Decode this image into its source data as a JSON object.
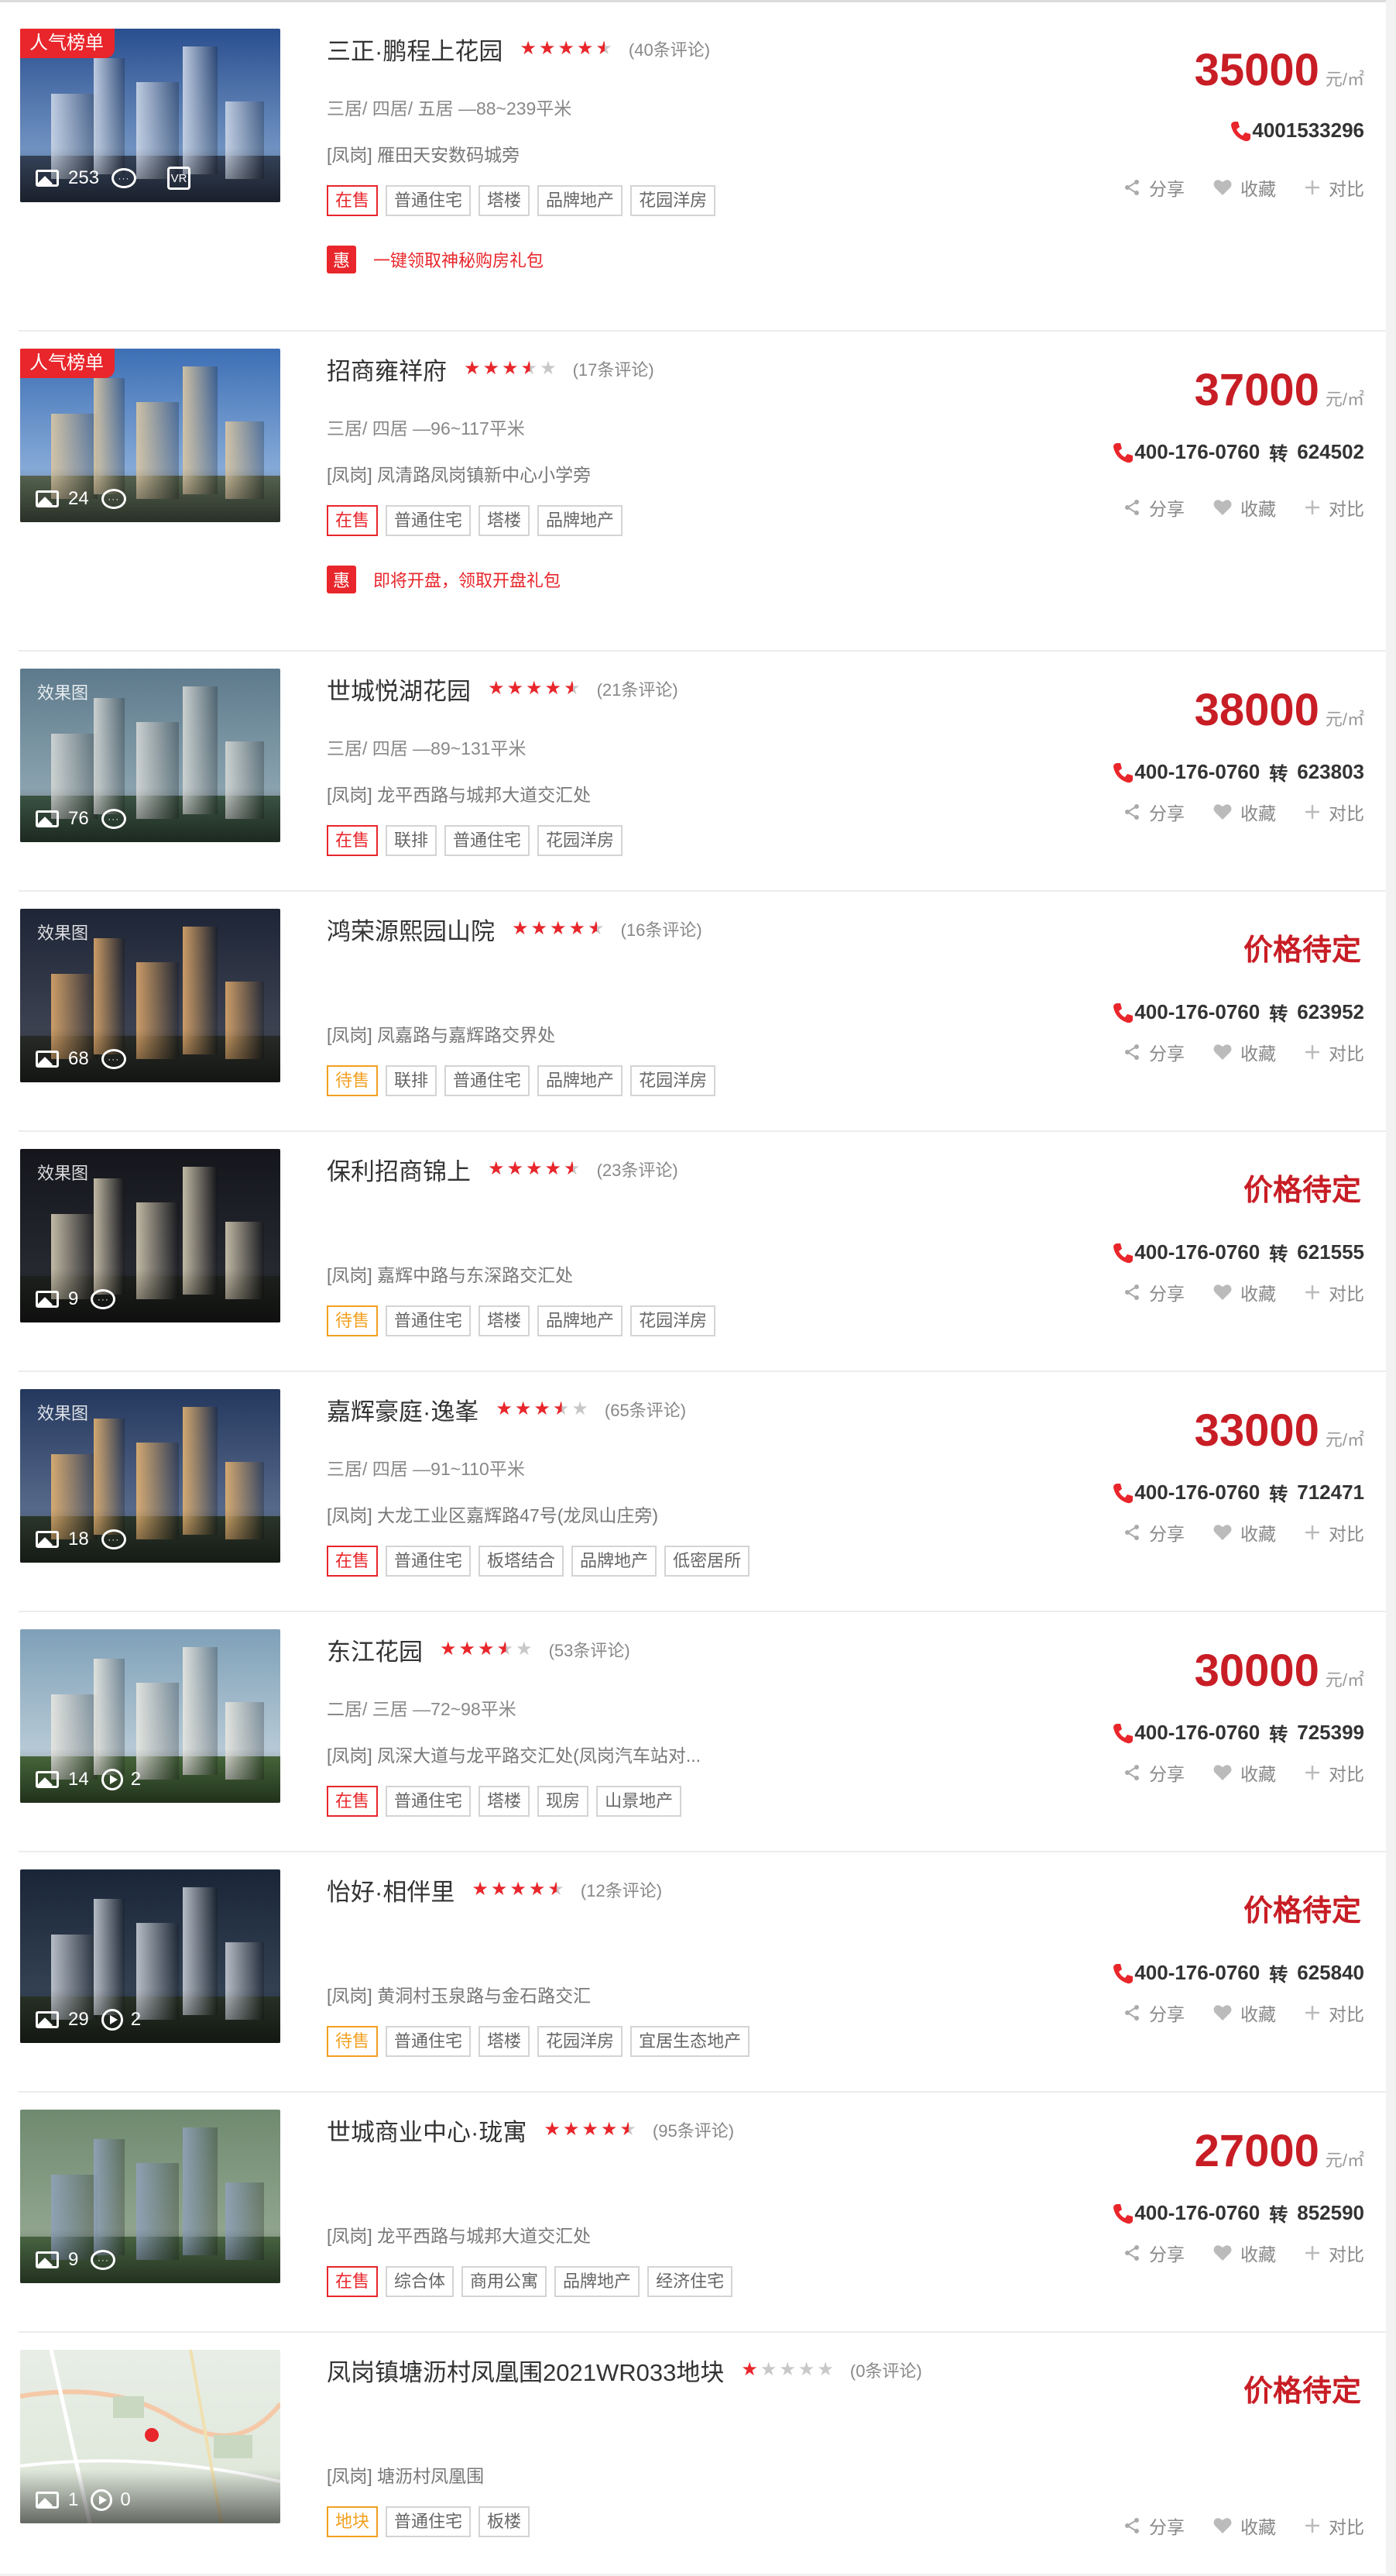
{
  "listings": [
    {
      "title": "三正·鹏程上花园",
      "stars": [
        1,
        1,
        1,
        1,
        0.5
      ],
      "reviews": "(40条评论)",
      "rooms": "三居/ 四居/ 五居 —88~239平米",
      "address": "[凤岗] 雁田天安数码城旁",
      "tags": [
        {
          "label": "在售",
          "kind": "onsale"
        },
        {
          "label": "普通住宅",
          "kind": "normal"
        },
        {
          "label": "塔楼",
          "kind": "normal"
        },
        {
          "label": "品牌地产",
          "kind": "normal"
        },
        {
          "label": "花园洋房",
          "kind": "normal"
        }
      ],
      "promo": {
        "icon": "惠",
        "text": "一键领取神秘购房礼包"
      },
      "price": "35000",
      "unit": "元/㎡",
      "phone": "4001533296",
      "zhuan": "",
      "ext": "",
      "hot": "人气榜单",
      "overlay": "",
      "photos": "253",
      "videos": "",
      "vr": true,
      "palette": {
        "sky": "#2a4f8f",
        "sky2": "#8fb0d8",
        "ground": "#38465e",
        "bldg": "#c9d4e6"
      }
    },
    {
      "title": "招商雍祥府",
      "stars": [
        1,
        1,
        1,
        0.5,
        0
      ],
      "reviews": "(17条评论)",
      "rooms": "三居/ 四居 —96~117平米",
      "address": "[凤岗] 凤清路凤岗镇新中心小学旁",
      "tags": [
        {
          "label": "在售",
          "kind": "onsale"
        },
        {
          "label": "普通住宅",
          "kind": "normal"
        },
        {
          "label": "塔楼",
          "kind": "normal"
        },
        {
          "label": "品牌地产",
          "kind": "normal"
        }
      ],
      "promo": {
        "icon": "惠",
        "text": "即将开盘，领取开盘礼包"
      },
      "price": "37000",
      "unit": "元/㎡",
      "phone": "400-176-0760",
      "zhuan": "转",
      "ext": "624502",
      "hot": "人气榜单",
      "overlay": "",
      "photos": "24",
      "videos": "",
      "vr": false,
      "palette": {
        "sky": "#3d6fb5",
        "sky2": "#a6c4e6",
        "ground": "#5b6a55",
        "bldg": "#d8c6a4"
      }
    },
    {
      "title": "世城悦湖花园",
      "stars": [
        1,
        1,
        1,
        1,
        0.5
      ],
      "reviews": "(21条评论)",
      "rooms": "三居/ 四居 —89~131平米",
      "address": "[凤岗] 龙平西路与城邦大道交汇处",
      "tags": [
        {
          "label": "在售",
          "kind": "onsale"
        },
        {
          "label": "联排",
          "kind": "normal"
        },
        {
          "label": "普通住宅",
          "kind": "normal"
        },
        {
          "label": "花园洋房",
          "kind": "normal"
        }
      ],
      "promo": null,
      "price": "38000",
      "unit": "元/㎡",
      "phone": "400-176-0760",
      "zhuan": "转",
      "ext": "623803",
      "hot": "",
      "overlay": "效果图",
      "photos": "76",
      "videos": "",
      "vr": false,
      "palette": {
        "sky": "#5d7a8c",
        "sky2": "#9db4bd",
        "ground": "#3f5a48",
        "bldg": "#d2d6d4"
      }
    },
    {
      "title": "鸿荣源熙园山院",
      "stars": [
        1,
        1,
        1,
        1,
        0.5
      ],
      "reviews": "(16条评论)",
      "rooms": "",
      "address": "[凤岗] 凤嘉路与嘉辉路交界处",
      "tags": [
        {
          "label": "待售",
          "kind": "pending"
        },
        {
          "label": "联排",
          "kind": "normal"
        },
        {
          "label": "普通住宅",
          "kind": "normal"
        },
        {
          "label": "品牌地产",
          "kind": "normal"
        },
        {
          "label": "花园洋房",
          "kind": "normal"
        }
      ],
      "promo": null,
      "price": "",
      "price_tbd": "价格待定",
      "unit": "",
      "phone": "400-176-0760",
      "zhuan": "转",
      "ext": "623952",
      "hot": "",
      "overlay": "效果图",
      "photos": "68",
      "videos": "",
      "vr": false,
      "palette": {
        "sky": "#1d2536",
        "sky2": "#4a4e5c",
        "ground": "#2a2e2a",
        "bldg": "#d9a56a"
      }
    },
    {
      "title": "保利招商锦上",
      "stars": [
        1,
        1,
        1,
        1,
        0.5
      ],
      "reviews": "(23条评论)",
      "rooms": "",
      "address": "[凤岗] 嘉辉中路与东深路交汇处",
      "tags": [
        {
          "label": "待售",
          "kind": "pending"
        },
        {
          "label": "普通住宅",
          "kind": "normal"
        },
        {
          "label": "塔楼",
          "kind": "normal"
        },
        {
          "label": "品牌地产",
          "kind": "normal"
        },
        {
          "label": "花园洋房",
          "kind": "normal"
        }
      ],
      "promo": null,
      "price": "",
      "price_tbd": "价格待定",
      "unit": "",
      "phone": "400-176-0760",
      "zhuan": "转",
      "ext": "621555",
      "hot": "",
      "overlay": "效果图",
      "photos": "9",
      "videos": "",
      "vr": false,
      "palette": {
        "sky": "#14161c",
        "sky2": "#2e3038",
        "ground": "#1f221f",
        "bldg": "#cfc6b0"
      }
    },
    {
      "title": "嘉辉豪庭·逸峯",
      "stars": [
        1,
        1,
        1,
        0.5,
        0
      ],
      "reviews": "(65条评论)",
      "rooms": "三居/ 四居 —91~110平米",
      "address": "[凤岗] 大龙工业区嘉辉路47号(龙凤山庄旁)",
      "tags": [
        {
          "label": "在售",
          "kind": "onsale"
        },
        {
          "label": "普通住宅",
          "kind": "normal"
        },
        {
          "label": "板塔结合",
          "kind": "normal"
        },
        {
          "label": "品牌地产",
          "kind": "normal"
        },
        {
          "label": "低密居所",
          "kind": "normal"
        }
      ],
      "promo": null,
      "price": "33000",
      "unit": "元/㎡",
      "phone": "400-176-0760",
      "zhuan": "转",
      "ext": "712471",
      "hot": "",
      "overlay": "效果图",
      "photos": "18",
      "videos": "",
      "vr": false,
      "palette": {
        "sky": "#24385e",
        "sky2": "#6d7f9e",
        "ground": "#2e3a2e",
        "bldg": "#e0b070"
      }
    },
    {
      "title": "东江花园",
      "stars": [
        1,
        1,
        1,
        0.5,
        0
      ],
      "reviews": "(53条评论)",
      "rooms": "二居/ 三居 —72~98平米",
      "address": "[凤岗] 凤深大道与龙平路交汇处(凤岗汽车站对...",
      "tags": [
        {
          "label": "在售",
          "kind": "onsale"
        },
        {
          "label": "普通住宅",
          "kind": "normal"
        },
        {
          "label": "塔楼",
          "kind": "normal"
        },
        {
          "label": "现房",
          "kind": "normal"
        },
        {
          "label": "山景地产",
          "kind": "normal"
        }
      ],
      "promo": null,
      "price": "30000",
      "unit": "元/㎡",
      "phone": "400-176-0760",
      "zhuan": "转",
      "ext": "725399",
      "hot": "",
      "overlay": "",
      "photos": "14",
      "videos": "2",
      "vr": false,
      "palette": {
        "sky": "#7ea0b8",
        "sky2": "#cfdbe2",
        "ground": "#4a6d3e",
        "bldg": "#e6e6e0"
      }
    },
    {
      "title": "怡好·相伴里",
      "stars": [
        1,
        1,
        1,
        1,
        0.5
      ],
      "reviews": "(12条评论)",
      "rooms": "",
      "address": "[凤岗] 黄洞村玉泉路与金石路交汇",
      "tags": [
        {
          "label": "待售",
          "kind": "pending"
        },
        {
          "label": "普通住宅",
          "kind": "normal"
        },
        {
          "label": "塔楼",
          "kind": "normal"
        },
        {
          "label": "花园洋房",
          "kind": "normal"
        },
        {
          "label": "宜居生态地产",
          "kind": "normal"
        }
      ],
      "promo": null,
      "price": "",
      "price_tbd": "价格待定",
      "unit": "",
      "phone": "400-176-0760",
      "zhuan": "转",
      "ext": "625840",
      "hot": "",
      "overlay": "",
      "photos": "29",
      "videos": "2",
      "vr": false,
      "palette": {
        "sky": "#1a2638",
        "sky2": "#3e4c5e",
        "ground": "#2a3428",
        "bldg": "#c2c8d0"
      }
    },
    {
      "title": "世城商业中心·珑寓",
      "stars": [
        1,
        1,
        1,
        1,
        0.5
      ],
      "reviews": "(95条评论)",
      "rooms": "",
      "address": "[凤岗] 龙平西路与城邦大道交汇处",
      "tags": [
        {
          "label": "在售",
          "kind": "onsale"
        },
        {
          "label": "综合体",
          "kind": "normal"
        },
        {
          "label": "商用公寓",
          "kind": "normal"
        },
        {
          "label": "品牌地产",
          "kind": "normal"
        },
        {
          "label": "经济住宅",
          "kind": "normal"
        }
      ],
      "promo": null,
      "price": "27000",
      "unit": "元/㎡",
      "phone": "400-176-0760",
      "zhuan": "转",
      "ext": "852590",
      "hot": "",
      "overlay": "",
      "photos": "9",
      "videos": "",
      "vr": false,
      "palette": {
        "sky": "#6f8a70",
        "sky2": "#9fb09a",
        "ground": "#4d6b46",
        "bldg": "#8fa2b8"
      }
    },
    {
      "title": "凤岗镇塘沥村凤凰围2021WR033地块",
      "stars": [
        1,
        0,
        0,
        0,
        0
      ],
      "reviews": "(0条评论)",
      "rooms": "",
      "address": "[凤岗] 塘沥村凤凰围",
      "tags": [
        {
          "label": "地块",
          "kind": "pending"
        },
        {
          "label": "普通住宅",
          "kind": "normal"
        },
        {
          "label": "板楼",
          "kind": "normal"
        }
      ],
      "promo": null,
      "price": "",
      "price_tbd": "价格待定",
      "unit": "",
      "phone": "",
      "zhuan": "",
      "ext": "",
      "hot": "",
      "overlay": "",
      "photos": "1",
      "videos": "0",
      "vr": false,
      "map": true,
      "palette": {
        "sky": "#e8eee6",
        "sky2": "#dde6d8",
        "ground": "#d6e2d0",
        "bldg": "#cfdcc8"
      }
    }
  ],
  "actions": {
    "share": "分享",
    "favorite": "收藏",
    "compare": "对比"
  },
  "colors": {
    "accent": "#e8262b",
    "price": "#c81d25",
    "pending": "#f2a020"
  }
}
